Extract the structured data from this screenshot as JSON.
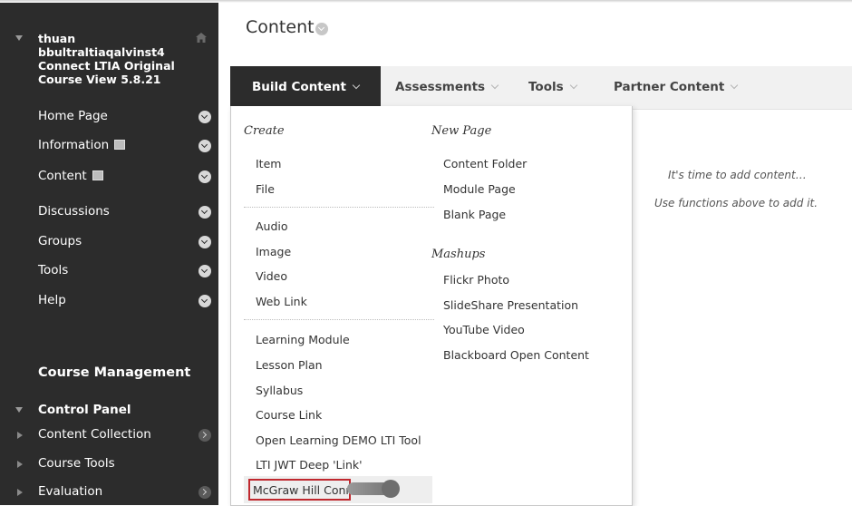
{
  "course": {
    "title": "thuan\nbbultraltiaqalvinst4\nConnect LTIA Original\nCourse View 5.8.21"
  },
  "sidebar": {
    "items": [
      {
        "label": "Home Page",
        "page_icon": false
      },
      {
        "label": "Information",
        "page_icon": true
      },
      {
        "label": "Content",
        "page_icon": true
      },
      {
        "label": "Discussions",
        "page_icon": false
      },
      {
        "label": "Groups",
        "page_icon": false
      },
      {
        "label": "Tools",
        "page_icon": false
      },
      {
        "label": "Help",
        "page_icon": false
      }
    ],
    "course_management": "Course Management",
    "control_panel": "Control Panel",
    "panel_items": [
      {
        "label": "Content Collection",
        "arrow": true
      },
      {
        "label": "Course Tools",
        "arrow": false
      },
      {
        "label": "Evaluation",
        "arrow": true
      }
    ]
  },
  "page": {
    "title": "Content"
  },
  "action_bar": {
    "build_content": "Build Content",
    "assessments": "Assessments",
    "tools": "Tools",
    "partner_content": "Partner Content"
  },
  "empty_state": {
    "line1": "It's time to add content…",
    "line2": "Use functions above to add it."
  },
  "dropdown": {
    "create_heading": "Create",
    "create_groups": [
      [
        "Item",
        "File"
      ],
      [
        "Audio",
        "Image",
        "Video",
        "Web Link"
      ],
      [
        "Learning Module",
        "Lesson Plan",
        "Syllabus",
        "Course Link",
        "Open Learning DEMO LTI Tool",
        "LTI JWT Deep 'Link'",
        "McGraw Hill Connect"
      ]
    ],
    "new_page_heading": "New Page",
    "new_page_items": [
      "Content Folder",
      "Module Page",
      "Blank Page"
    ],
    "mashups_heading": "Mashups",
    "mashups_items": [
      "Flickr Photo",
      "SlideShare Presentation",
      "YouTube Video",
      "Blackboard Open Content"
    ]
  },
  "colors": {
    "sidebar_bg": "#2c2c2c",
    "highlight_border": "#c0282e"
  }
}
